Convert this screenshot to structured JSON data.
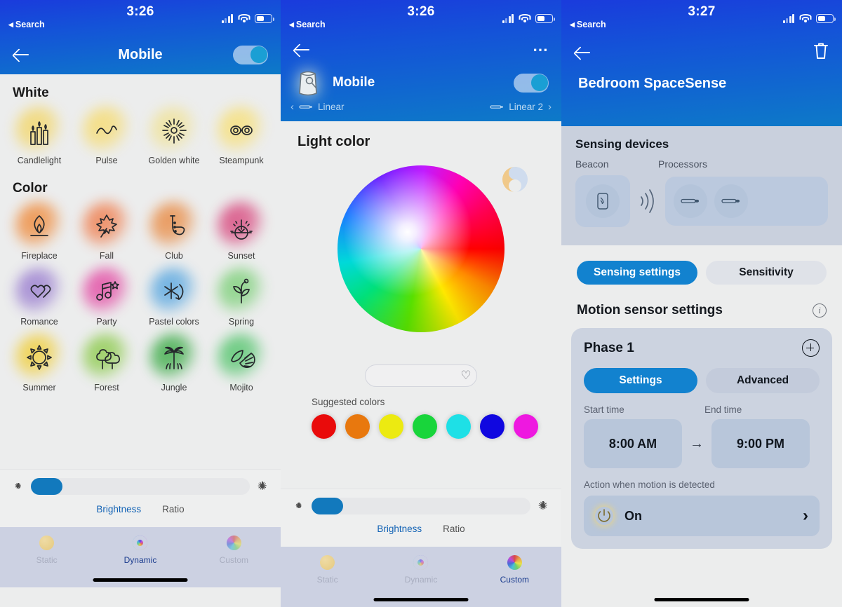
{
  "panels": [
    {
      "status": {
        "time": "3:26",
        "back_label": "Search",
        "back_icon": "triangle-left-icon"
      },
      "header": {
        "title": "Mobile",
        "back_icon": "back-arrow-icon",
        "toggle_state": "on"
      },
      "sections": [
        {
          "title": "White",
          "scenes": [
            {
              "label": "Candlelight",
              "icon": "candles-icon",
              "glow": "#f3d76b"
            },
            {
              "label": "Pulse",
              "icon": "wave-icon",
              "glow": "#f6dc73"
            },
            {
              "label": "Golden white",
              "icon": "starburst-icon",
              "glow": "#f0e39a"
            },
            {
              "label": "Steampunk",
              "icon": "goggles-icon",
              "glow": "#f7e07a"
            }
          ]
        },
        {
          "title": "Color",
          "scenes": [
            {
              "label": "Fireplace",
              "icon": "flame-icon",
              "glow": "#ef8b3c"
            },
            {
              "label": "Fall",
              "icon": "maple-leaf-icon",
              "glow": "#ef7f4f"
            },
            {
              "label": "Club",
              "icon": "saxophone-icon",
              "glow": "#e98b44"
            },
            {
              "label": "Sunset",
              "icon": "sunset-icon",
              "glow": "#d8487e"
            },
            {
              "label": "Romance",
              "icon": "hearts-icon",
              "glow": "#9b7fd0"
            },
            {
              "label": "Party",
              "icon": "music-notes-icon",
              "glow": "#e34ba4"
            },
            {
              "label": "Pastel colors",
              "icon": "asterisk-icon",
              "glow": "#59a7e0"
            },
            {
              "label": "Spring",
              "icon": "sprout-icon",
              "glow": "#7ed07a"
            },
            {
              "label": "Summer",
              "icon": "sun-icon",
              "glow": "#f0cf3e"
            },
            {
              "label": "Forest",
              "icon": "trees-icon",
              "glow": "#8ecb4e"
            },
            {
              "label": "Jungle",
              "icon": "palm-tree-icon",
              "glow": "#3bab46"
            },
            {
              "label": "Mojito",
              "icon": "lime-leaf-icon",
              "glow": "#55c56e"
            }
          ]
        }
      ],
      "brightness": {
        "left_icon": "brightness-low-icon",
        "right_icon": "brightness-high-icon",
        "value_percent": 12,
        "tabs": [
          {
            "label": "Brightness",
            "active": true
          },
          {
            "label": "Ratio",
            "active": false
          }
        ]
      },
      "tabbar": [
        {
          "label": "Static",
          "icon": "static-dot-icon",
          "active": false
        },
        {
          "label": "Dynamic",
          "icon": "dynamic-ring-icon",
          "active": true
        },
        {
          "label": "Custom",
          "icon": "custom-wheel-icon",
          "active": false
        }
      ]
    },
    {
      "status": {
        "time": "3:26",
        "back_label": "Search",
        "back_icon": "triangle-left-icon"
      },
      "header": {
        "device_name": "Mobile",
        "device_icon": "lamp-icon",
        "back_icon": "back-arrow-icon",
        "more_icon": "more-dots-icon",
        "toggle_state": "on",
        "prev_room": "Linear",
        "next_room": "Linear 2",
        "room_icon": "light-strip-icon"
      },
      "title": "Light color",
      "wheel": {
        "label": "color-wheel",
        "preview_icon": "warm-cool-toggle-icon"
      },
      "cct": {
        "favorite_icon": "heart-icon"
      },
      "suggested": {
        "label": "Suggested colors",
        "colors": [
          "#e90b0b",
          "#e8780e",
          "#ecea11",
          "#18d53b",
          "#1ee0e6",
          "#1007e0",
          "#ee18e0"
        ]
      },
      "brightness": {
        "left_icon": "brightness-low-icon",
        "right_icon": "brightness-high-icon",
        "value_percent": 12,
        "tabs": [
          {
            "label": "Brightness",
            "active": true
          },
          {
            "label": "Ratio",
            "active": false
          }
        ]
      },
      "tabbar": [
        {
          "label": "Static",
          "icon": "static-dot-icon",
          "active": false
        },
        {
          "label": "Dynamic",
          "icon": "dynamic-ring-icon",
          "active": false
        },
        {
          "label": "Custom",
          "icon": "custom-wheel-icon",
          "active": true
        }
      ]
    },
    {
      "status": {
        "time": "3:27",
        "back_label": "Search",
        "back_icon": "triangle-left-icon"
      },
      "header": {
        "title": "Bedroom SpaceSense",
        "back_icon": "back-arrow-icon",
        "delete_icon": "trash-icon"
      },
      "sensing": {
        "heading": "Sensing devices",
        "beacon_label": "Beacon",
        "processors_label": "Processors",
        "beacon_icon": "beacon-device-icon",
        "waves_icon": "signal-waves-icon",
        "processor_icon": "light-strip-icon"
      },
      "segments": [
        {
          "label": "Sensing settings",
          "active": true
        },
        {
          "label": "Sensitivity",
          "active": false
        }
      ],
      "motion": {
        "heading": "Motion sensor settings",
        "info_icon": "info-icon",
        "phase_title": "Phase 1",
        "add_icon": "plus-icon",
        "tabs": [
          {
            "label": "Settings",
            "active": true
          },
          {
            "label": "Advanced",
            "active": false
          }
        ],
        "start_label": "Start time",
        "end_label": "End time",
        "start_value": "8:00 AM",
        "end_value": "9:00 PM",
        "arrow_icon": "arrow-right-icon",
        "action_label": "Action when motion is detected",
        "action_value": "On",
        "action_icon": "power-icon",
        "action_chevron": "chevron-right-icon"
      }
    }
  ]
}
